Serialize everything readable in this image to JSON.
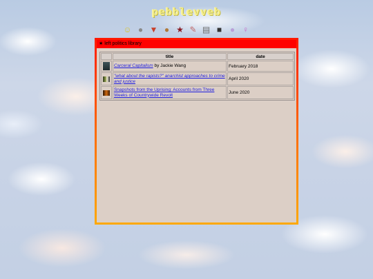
{
  "site": {
    "title": "pebblevveb"
  },
  "nav": {
    "icons": [
      {
        "name": "smiley-icon",
        "glyph": "☺",
        "color": "#d8c430"
      },
      {
        "name": "apple-icon",
        "glyph": "●",
        "color": "#8a8a8a"
      },
      {
        "name": "pride-triangle-icon",
        "glyph": "▼",
        "color": "#c8402a"
      },
      {
        "name": "palette-icon",
        "glyph": "●",
        "color": "#b07a3a"
      },
      {
        "name": "red-star-icon",
        "glyph": "★",
        "color": "#8a1a22"
      },
      {
        "name": "pencil-icon",
        "glyph": "✎",
        "color": "#c26a6a"
      },
      {
        "name": "notebook-icon",
        "glyph": "▤",
        "color": "#6a6a6a"
      },
      {
        "name": "camera-icon",
        "glyph": "■",
        "color": "#333333"
      },
      {
        "name": "bubble-icon",
        "glyph": "●",
        "color": "#b8a0d8"
      },
      {
        "name": "female-symbol-icon",
        "glyph": "♀",
        "color": "#c86ac8"
      }
    ]
  },
  "panel": {
    "header_star": "★",
    "header_text": "left politics library"
  },
  "table": {
    "columns": [
      "title",
      "date"
    ],
    "rows": [
      {
        "cover": "c1",
        "link_text": "Carceral Capitalism",
        "link_italic": true,
        "suffix": " by Jackie Wang",
        "date": "February 2018"
      },
      {
        "cover": "c2",
        "link_text": "\"what about the rapists?\" anarchist approaches to crime and justice",
        "link_italic": true,
        "suffix": "",
        "date": "April 2020"
      },
      {
        "cover": "c3",
        "link_text": "Snapshots from the Uprising: Accounts from Three Weeks of Countrywide Revolt",
        "link_italic": false,
        "suffix": "",
        "date": "June 2020"
      }
    ]
  }
}
